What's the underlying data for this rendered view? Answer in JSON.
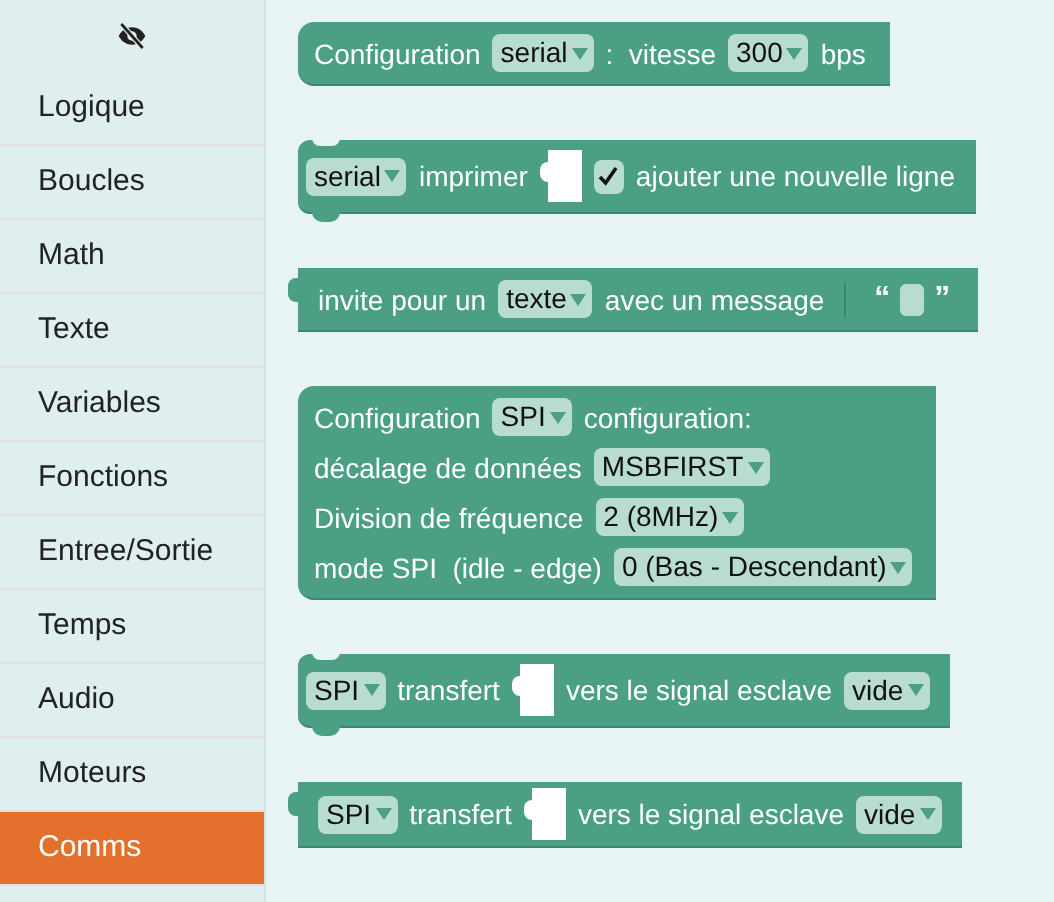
{
  "sidebar": {
    "items": [
      {
        "label": "Logique",
        "selected": false
      },
      {
        "label": "Boucles",
        "selected": false
      },
      {
        "label": "Math",
        "selected": false
      },
      {
        "label": "Texte",
        "selected": false
      },
      {
        "label": "Variables",
        "selected": false
      },
      {
        "label": "Fonctions",
        "selected": false
      },
      {
        "label": "Entree/Sortie",
        "selected": false
      },
      {
        "label": "Temps",
        "selected": false
      },
      {
        "label": "Audio",
        "selected": false
      },
      {
        "label": "Moteurs",
        "selected": false
      },
      {
        "label": "Comms",
        "selected": true
      }
    ]
  },
  "blocks": [
    {
      "kind": "top",
      "lines": [
        {
          "parts": [
            {
              "kind": "text",
              "text": "Configuration"
            },
            {
              "kind": "dropdown",
              "value": "serial"
            },
            {
              "kind": "text",
              "text": ":  vitesse"
            },
            {
              "kind": "dropdown",
              "value": "300"
            },
            {
              "kind": "text",
              "text": "bps"
            }
          ]
        }
      ]
    },
    {
      "kind": "statement",
      "lines": [
        {
          "parts": [
            {
              "kind": "dropdown",
              "value": "serial"
            },
            {
              "kind": "text",
              "text": "imprimer"
            },
            {
              "kind": "slot"
            },
            {
              "kind": "checkbox",
              "checked": true
            },
            {
              "kind": "text",
              "text": "ajouter une nouvelle ligne"
            }
          ]
        }
      ]
    },
    {
      "kind": "value",
      "lines": [
        {
          "parts": [
            {
              "kind": "text",
              "text": "invite pour un"
            },
            {
              "kind": "dropdown",
              "value": "texte"
            },
            {
              "kind": "text",
              "text": "avec un message"
            },
            {
              "kind": "string",
              "open": "“",
              "close": "”"
            }
          ]
        }
      ]
    },
    {
      "kind": "top",
      "lines": [
        {
          "parts": [
            {
              "kind": "text",
              "text": "Configuration"
            },
            {
              "kind": "dropdown",
              "value": "SPI"
            },
            {
              "kind": "text",
              "text": "configuration:"
            }
          ]
        },
        {
          "parts": [
            {
              "kind": "text",
              "text": "décalage de données"
            },
            {
              "kind": "dropdown",
              "value": "MSBFIRST"
            }
          ]
        },
        {
          "parts": [
            {
              "kind": "text",
              "text": "Division de fréquence"
            },
            {
              "kind": "dropdown",
              "value": "2 (8MHz)"
            }
          ]
        },
        {
          "parts": [
            {
              "kind": "text",
              "text": "mode SPI  (idle - edge)"
            },
            {
              "kind": "dropdown",
              "value": "0 (Bas - Descendant)"
            }
          ]
        }
      ]
    },
    {
      "kind": "statement",
      "lines": [
        {
          "parts": [
            {
              "kind": "dropdown",
              "value": "SPI"
            },
            {
              "kind": "text",
              "text": "transfert"
            },
            {
              "kind": "slot"
            },
            {
              "kind": "text",
              "text": "vers le signal esclave"
            },
            {
              "kind": "dropdown",
              "value": "vide"
            }
          ]
        }
      ]
    },
    {
      "kind": "value",
      "lines": [
        {
          "parts": [
            {
              "kind": "dropdown",
              "value": "SPI"
            },
            {
              "kind": "text",
              "text": "transfert"
            },
            {
              "kind": "slot"
            },
            {
              "kind": "text",
              "text": "vers le signal esclave"
            },
            {
              "kind": "dropdown",
              "value": "vide"
            }
          ]
        }
      ]
    }
  ]
}
